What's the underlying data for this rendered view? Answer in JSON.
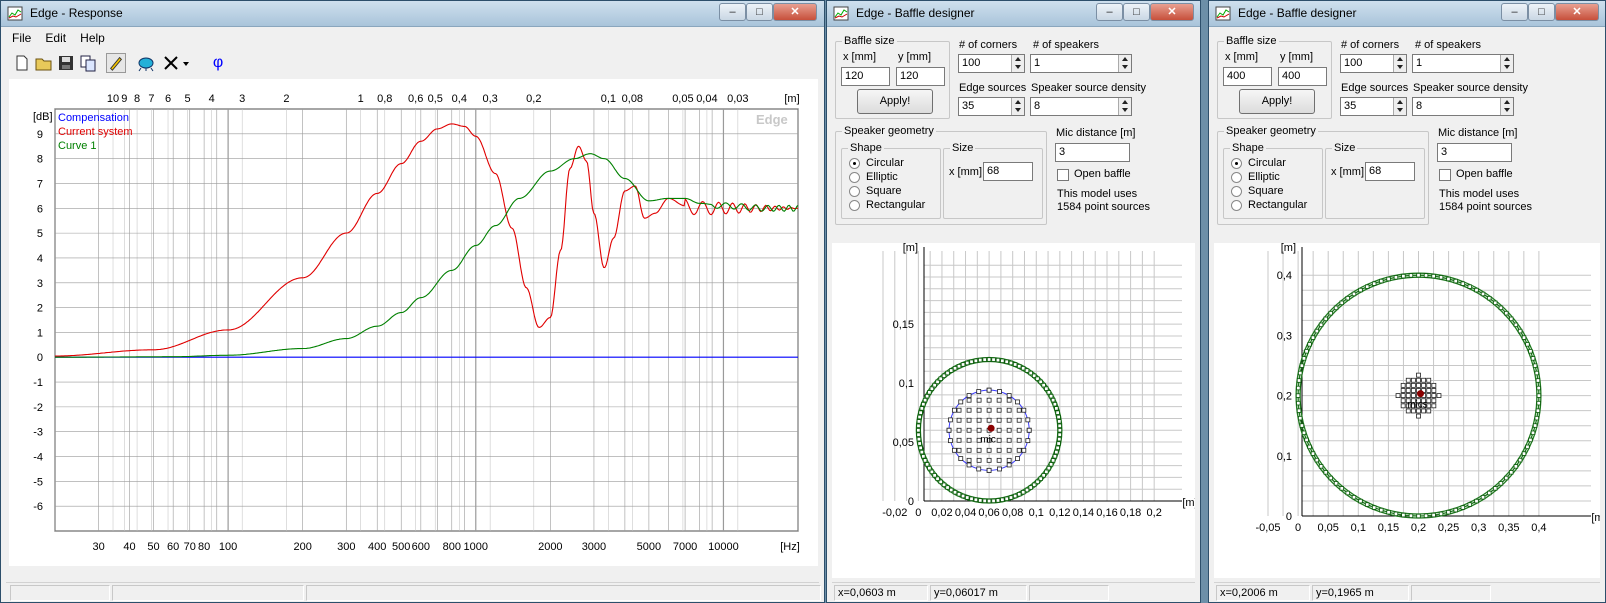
{
  "response": {
    "title": "Edge - Response",
    "menu": [
      "File",
      "Edit",
      "Help"
    ],
    "toolbar": {
      "phi": "φ"
    },
    "watermark": "Edge",
    "top_unit": "[m]",
    "top_ticks": [
      {
        "label": "10",
        "hz": 34.3
      },
      {
        "label": "9",
        "hz": 38.1
      },
      {
        "label": "8",
        "hz": 42.9
      },
      {
        "label": "7",
        "hz": 49.0
      },
      {
        "label": "6",
        "hz": 57.2
      },
      {
        "label": "5",
        "hz": 68.6
      },
      {
        "label": "4",
        "hz": 85.8
      },
      {
        "label": "3",
        "hz": 114
      },
      {
        "label": "2",
        "hz": 172
      },
      {
        "label": "1",
        "hz": 343
      },
      {
        "label": "0,8",
        "hz": 429
      },
      {
        "label": "0,6",
        "hz": 572
      },
      {
        "label": "0,5",
        "hz": 686
      },
      {
        "label": "0,4",
        "hz": 858
      },
      {
        "label": "0,3",
        "hz": 1143
      },
      {
        "label": "0,2",
        "hz": 1715
      },
      {
        "label": "0,1",
        "hz": 3430
      },
      {
        "label": "0,08",
        "hz": 4288
      },
      {
        "label": "0,05",
        "hz": 6860
      },
      {
        "label": "0,04",
        "hz": 8575
      },
      {
        "label": "0,03",
        "hz": 11433
      }
    ],
    "x_ticks": [
      {
        "label": "30",
        "hz": 30
      },
      {
        "label": "40",
        "hz": 40
      },
      {
        "label": "50",
        "hz": 50
      },
      {
        "label": "60",
        "hz": 60
      },
      {
        "label": "70",
        "hz": 70
      },
      {
        "label": "80",
        "hz": 80
      },
      {
        "label": "100",
        "hz": 100
      },
      {
        "label": "200",
        "hz": 200
      },
      {
        "label": "300",
        "hz": 300
      },
      {
        "label": "400",
        "hz": 400
      },
      {
        "label": "500",
        "hz": 500
      },
      {
        "label": "600",
        "hz": 600
      },
      {
        "label": "800",
        "hz": 800
      },
      {
        "label": "1000",
        "hz": 1000
      },
      {
        "label": "2000",
        "hz": 2000
      },
      {
        "label": "3000",
        "hz": 3000
      },
      {
        "label": "5000",
        "hz": 5000
      },
      {
        "label": "7000",
        "hz": 7000
      },
      {
        "label": "10000",
        "hz": 10000
      }
    ],
    "x_unit": "[Hz]",
    "y_unit": "[dB]",
    "y_ticks": [
      "9",
      "8",
      "7",
      "6",
      "5",
      "4",
      "3",
      "2",
      "1",
      "0",
      "-1",
      "-2",
      "-3",
      "-4",
      "-5",
      "-6"
    ],
    "colors": {
      "compensation": "#0000ff",
      "current": "#e00000",
      "curve1": "#008000",
      "grid": "#9a9a9a"
    }
  },
  "chart_data": {
    "type": "line",
    "xlabel": "[Hz]",
    "ylabel": "[dB]",
    "xscale": "log",
    "xlim": [
      20,
      20000
    ],
    "ylim": [
      -7,
      10
    ],
    "legend": "top-left",
    "grid": true,
    "series": [
      {
        "name": "Compensation",
        "x": [
          20,
          20000
        ],
        "y": [
          0,
          0
        ]
      },
      {
        "name": "Current system",
        "x": [
          20,
          50,
          100,
          200,
          300,
          400,
          500,
          600,
          700,
          800,
          900,
          1000,
          1200,
          1400,
          1600,
          1800,
          2000,
          2200,
          2400,
          2600,
          2800,
          3000,
          3300,
          3600,
          4000,
          4400,
          4800,
          5300,
          6000,
          7000,
          8000,
          9000,
          10000,
          12000,
          15000,
          20000
        ],
        "y": [
          0.05,
          0.3,
          1.1,
          3.2,
          5.0,
          6.6,
          7.8,
          8.7,
          9.2,
          9.4,
          9.3,
          8.9,
          7.4,
          5.2,
          2.8,
          1.2,
          1.6,
          4.3,
          7.6,
          8.5,
          7.9,
          5.8,
          3.6,
          4.8,
          6.7,
          6.9,
          5.6,
          5.8,
          6.4,
          6.1,
          6.0,
          6.0,
          6.0,
          6.0,
          6.0,
          6.0
        ]
      },
      {
        "name": "Curve 1",
        "x": [
          20,
          60,
          100,
          200,
          300,
          400,
          500,
          600,
          800,
          1000,
          1200,
          1500,
          2000,
          2500,
          2900,
          3300,
          4000,
          5000,
          6000,
          7000,
          8000,
          10000,
          15000,
          20000
        ],
        "y": [
          0,
          0.02,
          0.08,
          0.35,
          0.75,
          1.25,
          1.8,
          2.4,
          3.5,
          4.5,
          5.3,
          6.4,
          7.5,
          8.0,
          8.2,
          8.0,
          7.2,
          6.3,
          6.4,
          6.4,
          6.2,
          6.1,
          6.0,
          6.0
        ]
      }
    ]
  },
  "bd1": {
    "title": "Edge - Baffle designer",
    "baffle_size_label": "Baffle size",
    "x_label": "x [mm]",
    "x_value": "120",
    "y_label": "y [mm]",
    "y_value": "120",
    "apply_label": "Apply!",
    "corners_label": "# of corners",
    "corners_value": "100",
    "speakers_label": "# of speakers",
    "speakers_value": "1",
    "edge_label": "Edge sources",
    "edge_value": "35",
    "density_label": "Speaker source density",
    "density_value": "8",
    "geometry_label": "Speaker geometry",
    "shape_label": "Shape",
    "shapes": [
      "Circular",
      "Elliptic",
      "Square",
      "Rectangular"
    ],
    "size_label": "Size",
    "size_x_label": "x [mm]",
    "size_x_value": "68",
    "mic_label": "Mic distance [m]",
    "mic_value": "3",
    "open_baffle_label": "Open baffle",
    "model_text_1": "This model uses",
    "model_text_2": "1584 point sources",
    "axis_unit": "[m]",
    "y_ticks": [
      "0,15",
      "0,1",
      "0,05",
      "0"
    ],
    "x_ticks": [
      "-0,02",
      "0",
      "0,02",
      "0,04",
      "0,06",
      "0,08",
      "0,1",
      "0,12",
      "0,14",
      "0,16",
      "0,18",
      "0,2"
    ],
    "mic_text": "mic",
    "status_x": "x=0,0603 m",
    "status_y": "y=0,06017 m"
  },
  "bd2": {
    "title": "Edge - Baffle designer",
    "baffle_size_label": "Baffle size",
    "x_label": "x [mm]",
    "x_value": "400",
    "y_label": "y [mm]",
    "y_value": "400",
    "apply_label": "Apply!",
    "corners_label": "# of corners",
    "corners_value": "100",
    "speakers_label": "# of speakers",
    "speakers_value": "1",
    "edge_label": "Edge sources",
    "edge_value": "35",
    "density_label": "Speaker source density",
    "density_value": "8",
    "geometry_label": "Speaker geometry",
    "shape_label": "Shape",
    "shapes": [
      "Circular",
      "Elliptic",
      "Square",
      "Rectangular"
    ],
    "size_label": "Size",
    "size_x_label": "x [mm]",
    "size_x_value": "68",
    "mic_label": "Mic distance [m]",
    "mic_value": "3",
    "open_baffle_label": "Open baffle",
    "model_text_1": "This model uses",
    "model_text_2": "1584 point sources",
    "axis_unit": "[m]",
    "y_ticks": [
      "0,4",
      "0,3",
      "0,2",
      "0,1",
      "0"
    ],
    "x_ticks": [
      "-0,05",
      "0",
      "0,05",
      "0,1",
      "0,15",
      "0,2",
      "0,25",
      "0,3",
      "0,35",
      "0,4"
    ],
    "mic_text": "mics",
    "status_x": "x=0,2006 m",
    "status_y": "y=0,1965 m"
  }
}
